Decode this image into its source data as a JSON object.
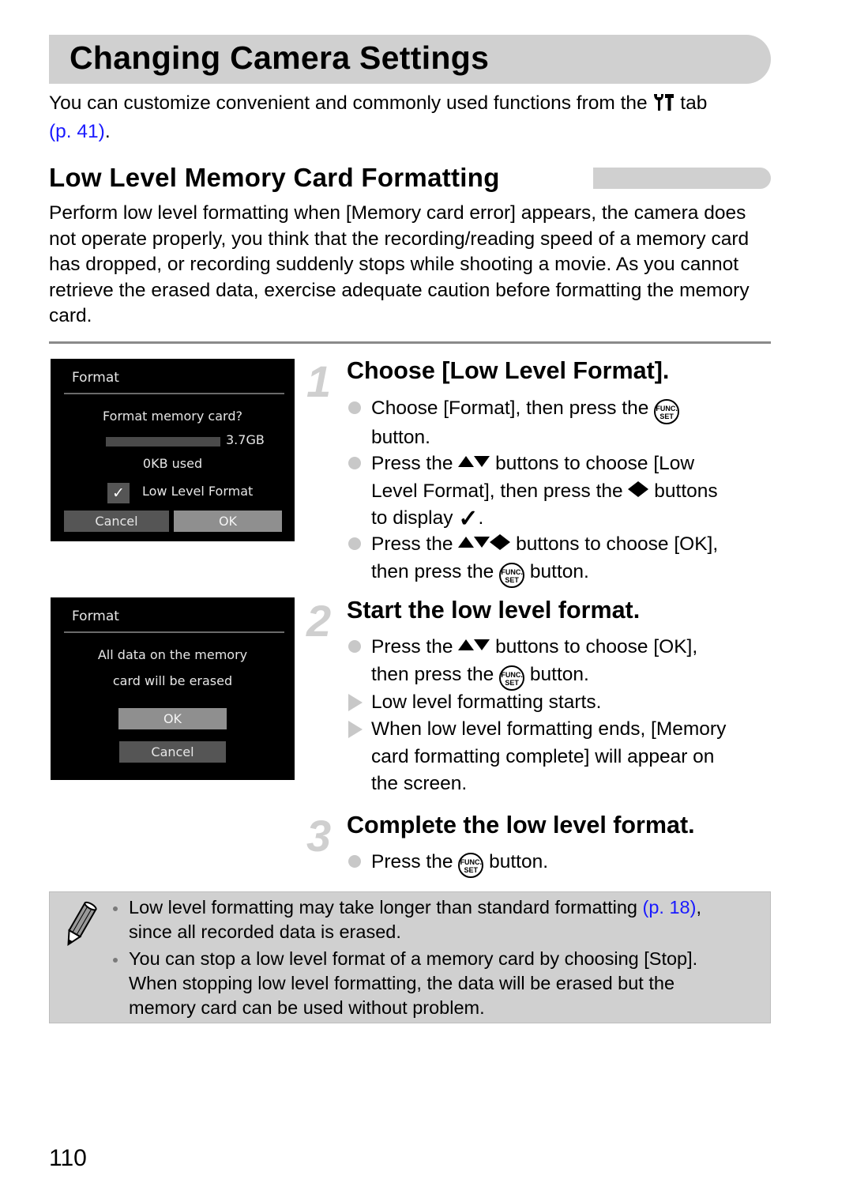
{
  "header": {
    "title": "Changing Camera Settings",
    "intro_text": "You can customize convenient and commonly used functions from the",
    "intro_icon": "wrench-tab-icon",
    "intro_tail": "tab",
    "intro_link": "(p. 41)",
    "intro_end": "."
  },
  "section": {
    "heading": "Low Level Memory Card Formatting",
    "body": "Perform low level formatting when [Memory card error] appears, the camera does not operate properly, you think that the recording/reading speed of a memory card has dropped, or recording suddenly stops while shooting a movie. As you cannot retrieve the erased data, exercise adequate caution before formatting the memory card."
  },
  "screens": [
    {
      "title": "Format",
      "question": "Format memory card?",
      "capacity": "3.7GB",
      "used": "0KB used",
      "checkbox_label": "Low Level Format",
      "checkbox_checked": true,
      "buttons": [
        "Cancel",
        "OK"
      ],
      "selected": "OK"
    },
    {
      "title": "Format",
      "message_line1": "All data on the memory",
      "message_line2": "card will be erased",
      "buttons": [
        "OK",
        "Cancel"
      ],
      "selected": "OK"
    }
  ],
  "steps": [
    {
      "number": "1",
      "title": "Choose [Low Level Format].",
      "items": [
        {
          "type": "bullet",
          "parts": [
            "Choose [Format], then press the",
            "button."
          ]
        },
        {
          "type": "bullet",
          "parts": [
            "Press the",
            "buttons to choose [Low",
            "Level Format], then press the",
            "buttons",
            "to display",
            "."
          ]
        },
        {
          "type": "bullet",
          "parts": [
            "Press the",
            "buttons to choose [OK],",
            "then press the",
            "button."
          ]
        }
      ]
    },
    {
      "number": "2",
      "title": "Start the low level format.",
      "items": [
        {
          "type": "bullet",
          "parts": [
            "Press the",
            "buttons to choose [OK],",
            "then press the",
            "button."
          ]
        },
        {
          "type": "result",
          "parts": [
            "Low level formatting starts."
          ]
        },
        {
          "type": "result",
          "parts": [
            "When low level formatting ends, [Memory",
            "card formatting complete] will appear on",
            "the screen."
          ]
        }
      ]
    },
    {
      "number": "3",
      "title": "Complete the low level format.",
      "items": [
        {
          "type": "bullet",
          "parts": [
            "Press the",
            "button."
          ]
        }
      ]
    }
  ],
  "icons": {
    "func_set_top": "FUNC.",
    "func_set_bottom": "SET",
    "checkmark": "✓"
  },
  "note": {
    "icon": "pencil-icon",
    "items": [
      {
        "text_before": "Low level formatting may take longer than standard formatting",
        "link": "(p. 18)",
        "text_after": ",",
        "line2": "since all recorded data is erased."
      },
      {
        "line1": "You can stop a low level format of a memory card by choosing [Stop].",
        "line2": "When stopping low level formatting, the data will be erased but the",
        "line3": "memory card can be used without problem."
      }
    ]
  },
  "colors": {
    "link": "#1a1aff",
    "bar_gray": "#d0d0d0"
  },
  "footer": {
    "page_number": "110"
  }
}
